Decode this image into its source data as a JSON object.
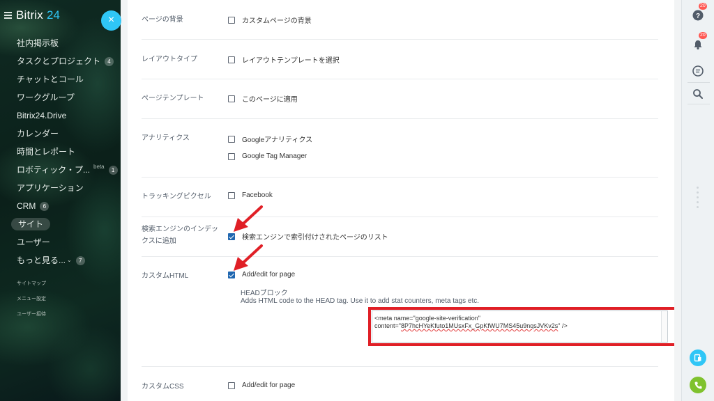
{
  "app": {
    "logo": "Bitrix",
    "logo_accent": "24"
  },
  "sidebar": {
    "items": [
      {
        "label": "社内掲示板"
      },
      {
        "label": "タスクとプロジェクト",
        "counter": "4"
      },
      {
        "label": "チャットとコール"
      },
      {
        "label": "ワークグループ"
      },
      {
        "label": "Bitrix24.Drive"
      },
      {
        "label": "カレンダー"
      },
      {
        "label": "時間とレポート"
      },
      {
        "label": "ロボティック・プ...",
        "beta": "beta",
        "counter": "1"
      },
      {
        "label": "アプリケーション"
      },
      {
        "label": "CRM",
        "counter": "6"
      },
      {
        "label": "サイト",
        "active": true
      },
      {
        "label": "ユーザー"
      },
      {
        "label": "もっと見る...",
        "counter": "7"
      }
    ],
    "links": [
      "サイトマップ",
      "メニュー設定",
      "ユーザー招待"
    ]
  },
  "close_icon": "×",
  "settings": {
    "page_background": {
      "label": "ページの背景",
      "option": "カスタムページの背景",
      "checked": false
    },
    "layout_type": {
      "label": "レイアウトタイプ",
      "option": "レイアウトテンプレートを選択",
      "checked": false
    },
    "page_template": {
      "label": "ページテンプレート",
      "option": "このページに適用",
      "checked": false
    },
    "analytics": {
      "label": "アナリティクス",
      "options": [
        {
          "label": "Googleアナリティクス",
          "checked": false
        },
        {
          "label": "Google Tag Manager",
          "checked": false
        }
      ]
    },
    "tracking_pixel": {
      "label": "トラッキングピクセル",
      "option": "Facebook",
      "checked": false
    },
    "search_index": {
      "label": "検索エンジンのインデックスに追加",
      "option": "検索エンジンで索引付けされたページのリスト",
      "checked": true
    },
    "custom_html": {
      "label": "カスタムHTML",
      "option": "Add/edit for page",
      "checked": true,
      "head_title": "HEADブロック",
      "head_desc": "Adds HTML code to the HEAD tag. Use it to add stat counters, meta tags etc.",
      "code_line1": "<meta name=\"google-site-verification\"",
      "code_line2_prefix": "content=\"",
      "code_line2_value": "8P7hcHYeKfuto1MUsxFx_GpKfWU7MS45u9nqsJVKv2s",
      "code_line2_suffix": "\" />"
    },
    "custom_css": {
      "label": "カスタムCSS",
      "option": "Add/edit for page",
      "checked": true
    }
  },
  "rail": {
    "help_badge": "20",
    "notifications_badge": "20",
    "icons": [
      "help-icon",
      "bell-icon",
      "chat-icon",
      "search-icon",
      "dashboard-icon",
      "phone-icon"
    ]
  },
  "colors": {
    "accent": "#2fc6f6",
    "highlight_red": "#e01f26",
    "checkbox_blue": "#2067b0",
    "phone_green": "#7fc22e"
  }
}
